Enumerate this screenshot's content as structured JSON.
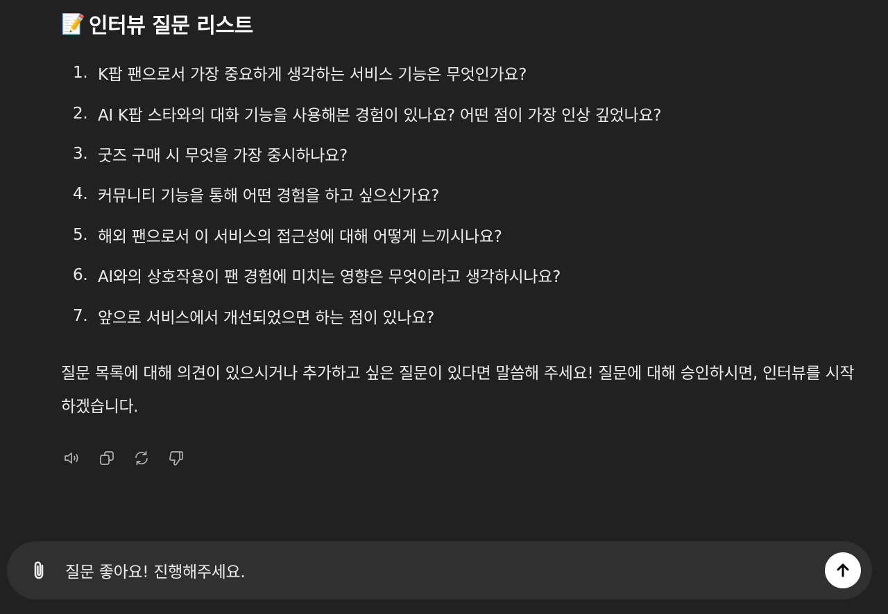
{
  "message": {
    "heading_emoji": "📝",
    "heading": "인터뷰 질문 리스트",
    "questions": [
      {
        "num": "1.",
        "text": "K팝 팬으로서 가장 중요하게 생각하는 서비스 기능은 무엇인가요?"
      },
      {
        "num": "2.",
        "text": "AI K팝 스타와의 대화 기능을 사용해본 경험이 있나요? 어떤 점이 가장 인상 깊었나요?"
      },
      {
        "num": "3.",
        "text": "굿즈 구매 시 무엇을 가장 중시하나요?"
      },
      {
        "num": "4.",
        "text": "커뮤니티 기능을 통해 어떤 경험을 하고 싶으신가요?"
      },
      {
        "num": "5.",
        "text": "해외 팬으로서 이 서비스의 접근성에 대해 어떻게 느끼시나요?"
      },
      {
        "num": "6.",
        "text": "AI와의 상호작용이 팬 경험에 미치는 영향은 무엇이라고 생각하시나요?"
      },
      {
        "num": "7.",
        "text": "앞으로 서비스에서 개선되었으면 하는 점이 있나요?"
      }
    ],
    "closing": "질문 목록에 대해 의견이 있으시거나 추가하고 싶은 질문이 있다면 말씀해 주세요! 질문에 대해 승인하시면, 인터뷰를 시작하겠습니다."
  },
  "actions": [
    {
      "icon": "speaker-icon"
    },
    {
      "icon": "copy-icon"
    },
    {
      "icon": "regenerate-icon"
    },
    {
      "icon": "thumbs-down-icon"
    }
  ],
  "composer": {
    "attach_icon": "paperclip-icon",
    "value": "질문 좋아요! 진행해주세요.",
    "send_icon": "arrow-up-icon"
  },
  "colors": {
    "background": "#212121",
    "composer_bg": "#303030",
    "text": "#ececec",
    "icon": "#b4b4b4",
    "send_bg": "#ffffff"
  }
}
